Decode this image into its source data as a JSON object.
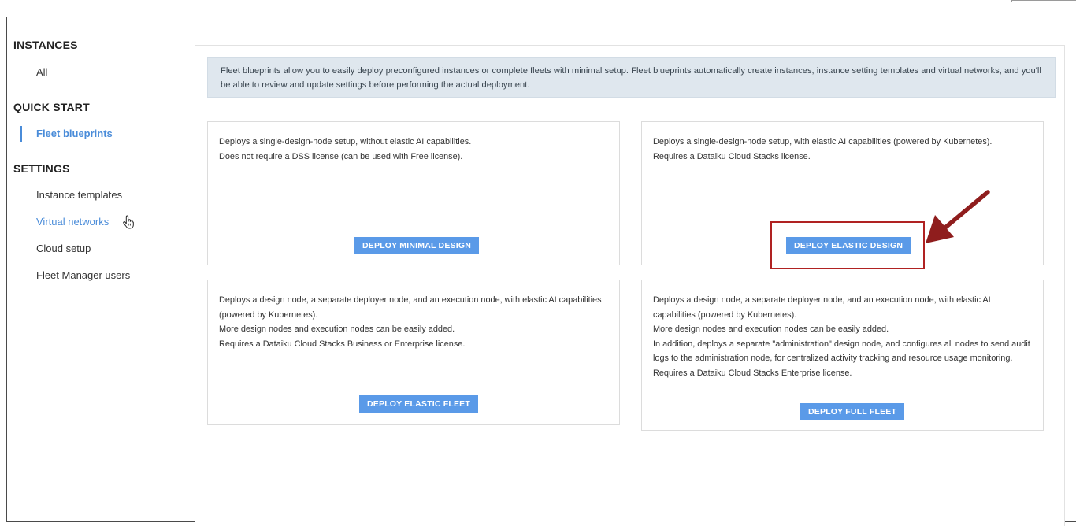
{
  "sidebar": {
    "sections": [
      {
        "title": "INSTANCES",
        "items": [
          {
            "label": "All",
            "state": "normal"
          }
        ]
      },
      {
        "title": "QUICK START",
        "items": [
          {
            "label": "Fleet blueprints",
            "state": "active"
          }
        ]
      },
      {
        "title": "SETTINGS",
        "items": [
          {
            "label": "Instance templates",
            "state": "normal"
          },
          {
            "label": "Virtual networks",
            "state": "link"
          },
          {
            "label": "Cloud setup",
            "state": "normal"
          },
          {
            "label": "Fleet Manager users",
            "state": "normal"
          }
        ]
      }
    ]
  },
  "main": {
    "info_banner": "Fleet blueprints allow you to easily deploy preconfigured instances or complete fleets with minimal setup. Fleet blueprints automatically create instances, instance setting templates and virtual networks, and you'll be able to review and update settings before performing the actual deployment.",
    "cards": [
      {
        "lines": [
          "Deploys a single-design-node setup, without elastic AI capabilities.",
          "Does not require a DSS license (can be used with Free license)."
        ],
        "button": "DEPLOY MINIMAL DESIGN"
      },
      {
        "lines": [
          "Deploys a single-design-node setup, with elastic AI capabilities (powered by Kubernetes).",
          "Requires a Dataiku Cloud Stacks license."
        ],
        "button": "DEPLOY ELASTIC DESIGN"
      },
      {
        "lines": [
          "Deploys a design node, a separate deployer node, and an execution node, with elastic AI capabilities (powered by Kubernetes).",
          "More design nodes and execution nodes can be easily added.",
          "Requires a Dataiku Cloud Stacks Business or Enterprise license."
        ],
        "button": "DEPLOY ELASTIC FLEET"
      },
      {
        "lines": [
          "Deploys a design node, a separate deployer node, and an execution node, with elastic AI capabilities (powered by Kubernetes).",
          "More design nodes and execution nodes can be easily added.",
          "In addition, deploys a separate \"administration\" design node, and configures all nodes to send audit logs to the administration node, for centralized activity tracking and resource usage monitoring.",
          "Requires a Dataiku Cloud Stacks Enterprise license."
        ],
        "button": "DEPLOY FULL FLEET"
      }
    ]
  },
  "annotation": {
    "color": "#b02222",
    "icon": "arrow-pointer-icon"
  },
  "cursor": {
    "icon": "hand-pointer-icon"
  },
  "colors": {
    "accent": "#4a8cd9",
    "button": "#5a9ae8",
    "banner_bg": "#dfe7ee"
  }
}
